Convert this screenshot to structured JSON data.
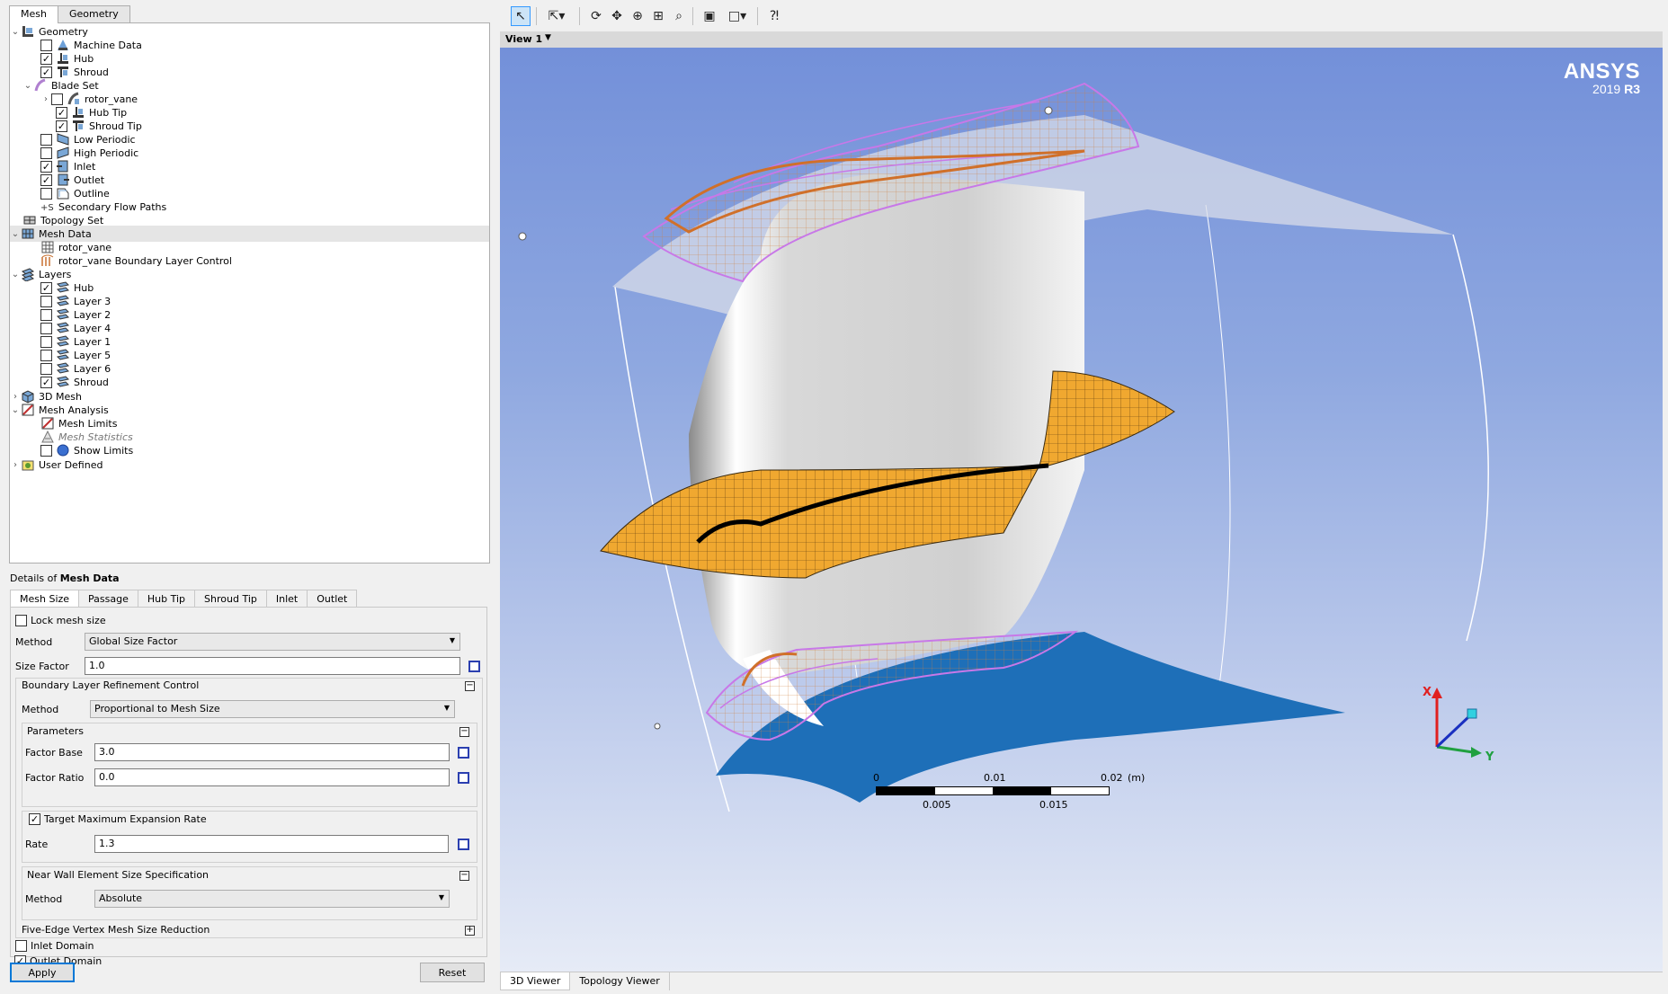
{
  "left_tabs": [
    "Mesh",
    "Geometry"
  ],
  "tree": {
    "geometry": "Geometry",
    "machine_data": "Machine Data",
    "hub": "Hub",
    "shroud": "Shroud",
    "blade_set": "Blade Set",
    "rotor_vane": "rotor_vane",
    "hub_tip": "Hub Tip",
    "shroud_tip": "Shroud Tip",
    "low_periodic": "Low Periodic",
    "high_periodic": "High Periodic",
    "inlet": "Inlet",
    "outlet": "Outlet",
    "outline": "Outline",
    "secondary_flow_paths": "Secondary Flow Paths",
    "topology_set": "Topology Set",
    "mesh_data": "Mesh Data",
    "mesh_rotor_vane": "rotor_vane",
    "boundary_layer_control": "rotor_vane Boundary Layer Control",
    "layers": "Layers",
    "layer_hub": "Hub",
    "layer3": "Layer 3",
    "layer2": "Layer 2",
    "layer4": "Layer 4",
    "layer1": "Layer 1",
    "layer5": "Layer 5",
    "layer6": "Layer 6",
    "layer_shroud": "Shroud",
    "mesh3d": "3D Mesh",
    "mesh_analysis": "Mesh Analysis",
    "mesh_limits": "Mesh Limits",
    "mesh_statistics": "Mesh Statistics",
    "show_limits": "Show Limits",
    "user_defined": "User Defined"
  },
  "details": {
    "title_prefix": "Details of ",
    "title_object": "Mesh Data",
    "tabs": [
      "Mesh Size",
      "Passage",
      "Hub Tip",
      "Shroud Tip",
      "Inlet",
      "Outlet"
    ],
    "lock_mesh_size": "Lock mesh size",
    "method_label": "Method",
    "method_value": "Global Size Factor",
    "size_factor_label": "Size Factor",
    "size_factor_value": "1.0",
    "blrc_title": "Boundary Layer Refinement Control",
    "blrc_method_label": "Method",
    "blrc_method_value": "Proportional to Mesh Size",
    "parameters_title": "Parameters",
    "factor_base_label": "Factor Base",
    "factor_base_value": "3.0",
    "factor_ratio_label": "Factor Ratio",
    "factor_ratio_value": "0.0",
    "target_max_exp_rate": "Target Maximum Expansion Rate",
    "rate_label": "Rate",
    "rate_value": "1.3",
    "near_wall_title": "Near Wall Element Size Specification",
    "near_wall_method_label": "Method",
    "near_wall_method_value": "Absolute",
    "five_edge_title": "Five-Edge Vertex Mesh Size Reduction",
    "inlet_domain": "Inlet Domain",
    "outlet_domain": "Outlet Domain",
    "apply": "Apply",
    "reset": "Reset"
  },
  "viewer": {
    "view_name": "View 1",
    "brand": "ANSYS",
    "version_year": "2019",
    "version_rel": "R3",
    "scale_top": [
      "0",
      "0.01",
      "0.02",
      "(m)"
    ],
    "scale_bottom": [
      "0.005",
      "0.015"
    ],
    "axis_x": "X",
    "axis_y": "Y",
    "tabs": [
      "3D Viewer",
      "Topology Viewer"
    ]
  },
  "colors": {
    "viewport_top": "#7390d9",
    "viewport_bottom": "#e6ebf6",
    "mesh_orange": "#f0a830",
    "mesh_edge_purple": "#c878e8",
    "hub_blue": "#1e6fb8",
    "accent_blue": "#2b3fb0"
  }
}
